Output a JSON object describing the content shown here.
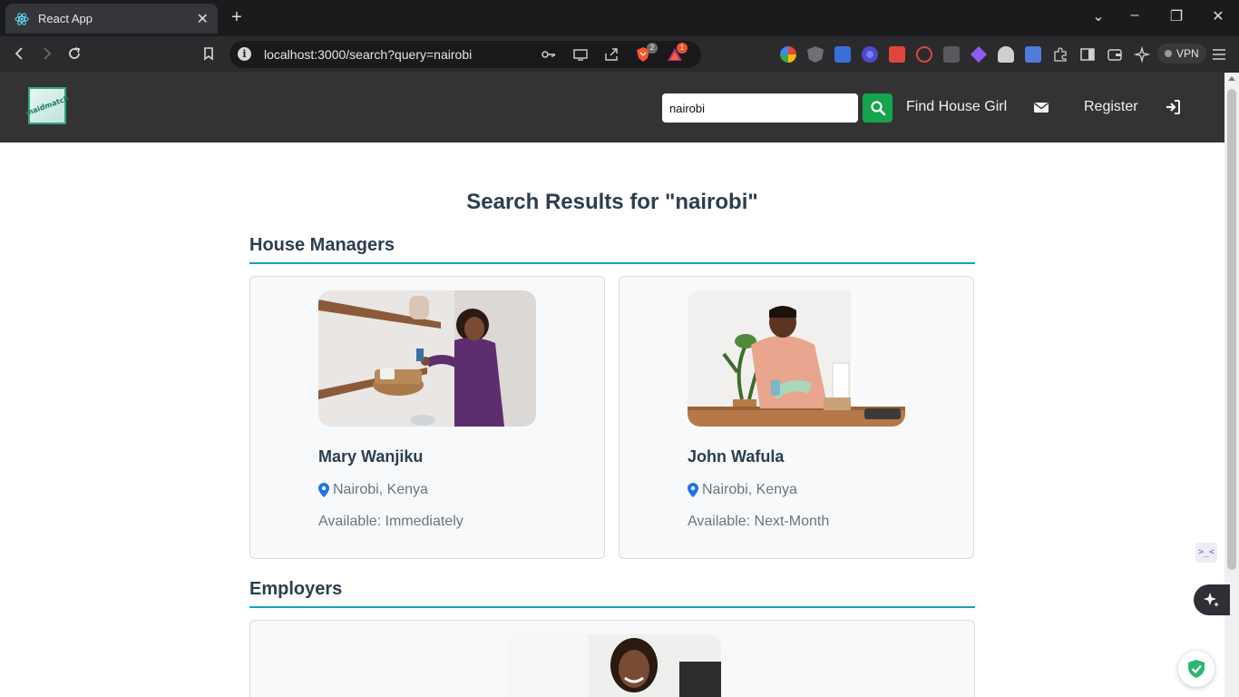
{
  "browser": {
    "tab_title": "React App",
    "url": "localhost:3000/search?query=nairobi",
    "brave_badge": "2",
    "rewards_badge": "1",
    "vpn_label": "VPN"
  },
  "header": {
    "search_value": "nairobi",
    "nav_find": "Find House Girl",
    "nav_register": "Register"
  },
  "page": {
    "title": "Search Results for \"nairobi\""
  },
  "house_managers": {
    "heading": "House Managers",
    "cards": [
      {
        "name": "Mary Wanjiku",
        "location": "Nairobi, Kenya",
        "availability": "Available: Immediately"
      },
      {
        "name": "John Wafula",
        "location": "Nairobi, Kenya",
        "availability": "Available: Next-Month"
      }
    ]
  },
  "employers": {
    "heading": "Employers"
  },
  "colors": {
    "header_bg": "#333333",
    "accent_green": "#14a44d",
    "section_rule": "#17a2b8",
    "heading_text": "#2c3e50",
    "pin_blue": "#1a73e8"
  }
}
